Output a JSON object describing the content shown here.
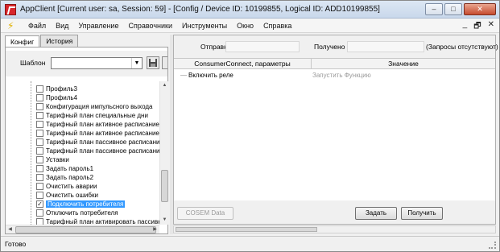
{
  "window": {
    "title": "AppClient  [Current user: sa, Session: 59] - [Config / Device ID: 10199855, Logical ID: ADD10199855]",
    "min": "–",
    "max": "□",
    "close": "✕"
  },
  "menu": {
    "items": [
      "Файл",
      "Вид",
      "Управление",
      "Справочники",
      "Инструменты",
      "Окно",
      "Справка"
    ],
    "mdi": [
      "_",
      "🗗",
      "✕"
    ]
  },
  "left": {
    "tabs": [
      "Конфиг",
      "История"
    ],
    "template_label": "Шаблон",
    "template_value": "",
    "tree": [
      {
        "label": "Профиль3",
        "checked": false
      },
      {
        "label": "Профиль4",
        "checked": false
      },
      {
        "label": "Конфигурация импульсного выхода",
        "checked": false
      },
      {
        "label": "Тарифный план специальные дни",
        "checked": false
      },
      {
        "label": "Тарифный план активное расписание",
        "checked": false
      },
      {
        "label": "Тарифный план активное расписание,",
        "checked": false
      },
      {
        "label": "Тарифный план пассивное расписание",
        "checked": false
      },
      {
        "label": "Тарифный план пассивное расписание,",
        "checked": false
      },
      {
        "label": "Уставки",
        "checked": false
      },
      {
        "label": "Задать пароль1",
        "checked": false
      },
      {
        "label": "Задать пароль2",
        "checked": false
      },
      {
        "label": "Очистить аварии",
        "checked": false
      },
      {
        "label": "Очистить ошибки",
        "checked": false
      },
      {
        "label": "Подключить потребителя",
        "checked": true,
        "selected": true
      },
      {
        "label": "Отключить потребителя",
        "checked": false
      },
      {
        "label": "Тарифный план активировать пассивн",
        "checked": false
      }
    ]
  },
  "right": {
    "sent_label": "Отправк",
    "received_label": "Получено",
    "requests_note": "(Запросы отсутствуют)",
    "grid": {
      "col1": "ConsumerConnect, параметры",
      "col2": "Значение",
      "row_name": "Включить реле",
      "row_value": "Запустить Функцию"
    },
    "cosem_button": "COSEM Data",
    "set_button": "Задать",
    "get_button": "Получить"
  },
  "status": {
    "text": "Готово"
  }
}
